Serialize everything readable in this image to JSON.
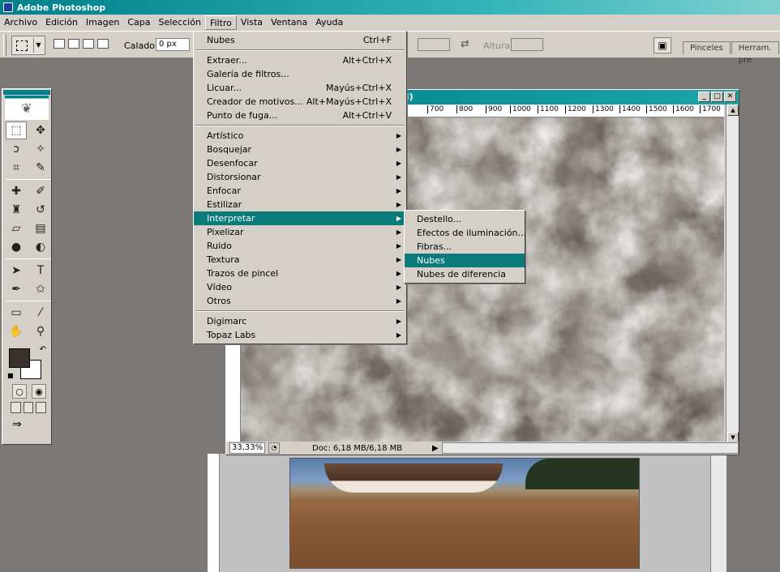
{
  "app": {
    "title": "Adobe Photoshop"
  },
  "menubar": [
    "Archivo",
    "Edición",
    "Imagen",
    "Capa",
    "Selección",
    "Filtro",
    "Vista",
    "Ventana",
    "Ayuda"
  ],
  "options": {
    "feather_label": "Calado:",
    "feather_value": "0 px",
    "height_label": "Altura:",
    "palette_tabs": [
      "Pinceles",
      "Herram. pre"
    ]
  },
  "document": {
    "title_fragment": "8)",
    "ruler_marks": [
      "700",
      "800",
      "900",
      "1000",
      "1100",
      "1200",
      "1300",
      "1400",
      "1500",
      "1600",
      "1700"
    ],
    "zoom": "33,33%",
    "doc_info": "Doc: 6,18 MB/6,18 MB"
  },
  "filter_menu": {
    "group1": [
      {
        "label": "Nubes",
        "shortcut": "Ctrl+F"
      }
    ],
    "group2": [
      {
        "label": "Extraer...",
        "shortcut": "Alt+Ctrl+X"
      },
      {
        "label": "Galería de filtros...",
        "shortcut": ""
      },
      {
        "label": "Licuar...",
        "shortcut": "Mayús+Ctrl+X"
      },
      {
        "label": "Creador de motivos...",
        "shortcut": "Alt+Mayús+Ctrl+X"
      },
      {
        "label": "Punto de fuga...",
        "shortcut": "Alt+Ctrl+V"
      }
    ],
    "group3": [
      "Artístico",
      "Bosquejar",
      "Desenfocar",
      "Distorsionar",
      "Enfocar",
      "Estilizar",
      "Interpretar",
      "Pixelizar",
      "Ruido",
      "Textura",
      "Trazos de pincel",
      "Vídeo",
      "Otros"
    ],
    "group4": [
      "Digimarc",
      "Topaz Labs"
    ],
    "highlighted": "Interpretar"
  },
  "submenu": {
    "items": [
      "Destello...",
      "Efectos de iluminación...",
      "Fibras...",
      "Nubes",
      "Nubes de diferencia"
    ],
    "highlighted": "Nubes"
  },
  "colors": {
    "accent": "#0a7a7a",
    "titlebar": "#00808a",
    "foreground": "#3a312c",
    "background": "#ffffff"
  }
}
